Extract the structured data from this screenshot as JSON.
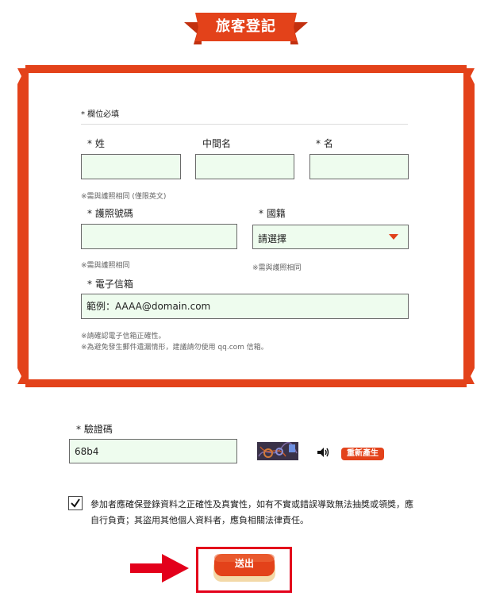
{
  "title": "旅客登記",
  "form": {
    "required_note": "* 欄位必填",
    "surname_label": "* 姓",
    "middle_label": "中間名",
    "given_label": "* 名",
    "name_hint": "※需與護照相同 (僅限英文)",
    "passport_label": "* 護照號碼",
    "passport_hint": "※需與護照相同",
    "nationality_label": "* 國籍",
    "nationality_value": "請選擇",
    "nationality_hint": "※需與護照相同",
    "email_label": "* 電子信箱",
    "email_placeholder": "範例：AAAA@domain.com",
    "email_hint_1": "※請確認電子信箱正確性。",
    "email_hint_2": "※為避免發生郵件遺漏情形，建議請勿使用 qq.com 信箱。"
  },
  "captcha": {
    "label": "* 驗證碼",
    "value": "68b4",
    "regenerate_label": "重新產生"
  },
  "agreement": {
    "checked": true,
    "text": "參加者應確保登錄資料之正確性及真實性，如有不實或錯誤導致無法抽獎或領獎，應自行負責；其盜用其他個人資料者，應負相關法律責任。"
  },
  "submit_label": "送出",
  "colors": {
    "accent": "#e3421a",
    "field_bg": "#eefcee",
    "highlight_red": "#e3001b"
  }
}
